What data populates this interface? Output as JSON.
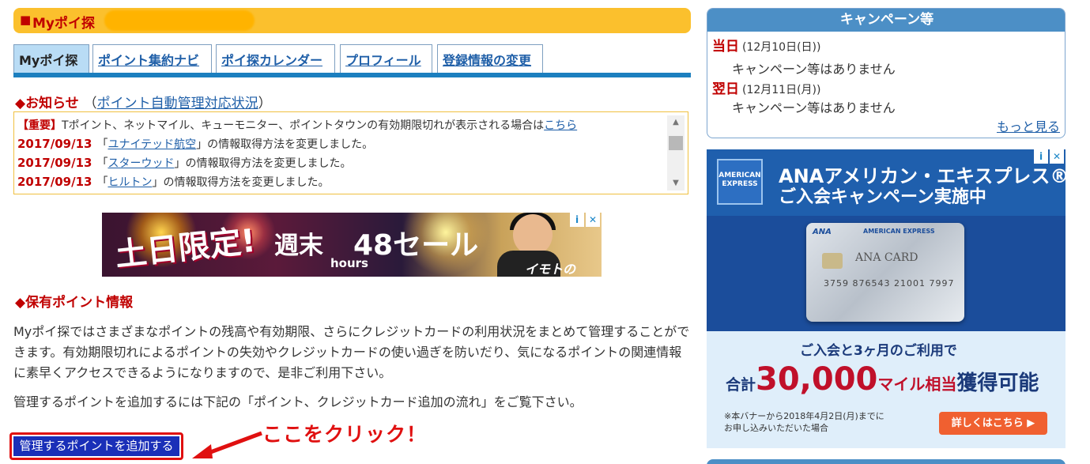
{
  "header": {
    "square": "■",
    "title": "Myポイ探"
  },
  "tabs": [
    {
      "label": "Myポイ探",
      "active": true
    },
    {
      "label": "ポイント集約ナビ",
      "active": false
    },
    {
      "label": "ポイ探カレンダー",
      "active": false
    },
    {
      "label": "プロフィール",
      "active": false
    },
    {
      "label": "登録情報の変更",
      "active": false
    }
  ],
  "notice": {
    "diamond": "◆",
    "heading": "お知らせ",
    "paren_open": "（",
    "link": "ポイント自動管理対応状況",
    "paren_close": "）",
    "important_tag": "【重要】",
    "important_text": "Tポイント、ネットマイル、キューモニター、ポイントタウンの有効期限切れが表示される場合は",
    "important_link": "こちら",
    "items": [
      {
        "date": "2017/09/13",
        "open": "「",
        "link": "ユナイテッド航空",
        "rest": "」の情報取得方法を変更しました。"
      },
      {
        "date": "2017/09/13",
        "open": "「",
        "link": "スターウッド",
        "rest": "」の情報取得方法を変更しました。"
      },
      {
        "date": "2017/09/13",
        "open": "「",
        "link": "ヒルトン",
        "rest": "」の情報取得方法を変更しました。"
      }
    ],
    "scroll_up": "▲",
    "scroll_down": "▼"
  },
  "ad_top": {
    "text1": "土日限定!",
    "text2": "週末",
    "text3": "48セール",
    "text4": "hours",
    "text5": "イモトのWiFi",
    "info": "i",
    "close": "✕"
  },
  "holding": {
    "diamond": "◆",
    "heading": "保有ポイント情報",
    "para1": "Myポイ探ではさまざまなポイントの残高や有効期限、さらにクレジットカードの利用状況をまとめて管理することができます。有効期限切れによるポイントの失効やクレジットカードの使い過ぎを防いだり、気になるポイントの関連情報に素早くアクセスできるようになりますので、是非ご利用下さい。",
    "para2": "管理するポイントを追加するには下記の「ポイント、クレジットカード追加の流れ」をご覧下さい。",
    "add_button": "管理するポイントを追加する",
    "callout": "ここをクリック！"
  },
  "campaign": {
    "title": "キャンペーン等",
    "today_label": "当日",
    "today_date": "(12月10日(日))",
    "today_text": "キャンペーン等はありません",
    "tomorrow_label": "翌日",
    "tomorrow_date": "(12月11日(月))",
    "tomorrow_text": "キャンペーン等はありません",
    "more": "もっと見る"
  },
  "ad_side": {
    "logo": "AMERICAN EXPRESS",
    "headline1": "ANAアメリカン・エキスプレス®・カード",
    "headline2": "ご入会キャンペーン実施中",
    "card_brand": "ANA",
    "card_issuer": "AMERICAN EXPRESS",
    "card_name": "ANA CARD",
    "card_number": "3759 876543 21001 7997",
    "sub1": "ご入会と3ヶ月のご利用で",
    "sub2_prefix": "合計",
    "sub2_big": "30,000",
    "sub2_mid": "マイル相当",
    "sub2_end": "獲得可能",
    "note1": "※本バナーから2018年4月2日(月)までに",
    "note2": "お申し込みいただいた場合",
    "button": "詳しくはこちら ▶",
    "info": "i",
    "close": "✕"
  },
  "colors": {
    "accent_red": "#c00000",
    "link_blue": "#1f5fa8",
    "header_yellow": "#fbc02d",
    "tab_bar_blue": "#1c7fbf",
    "button_blue": "#1a2fb8",
    "callout_red": "#e01010"
  }
}
